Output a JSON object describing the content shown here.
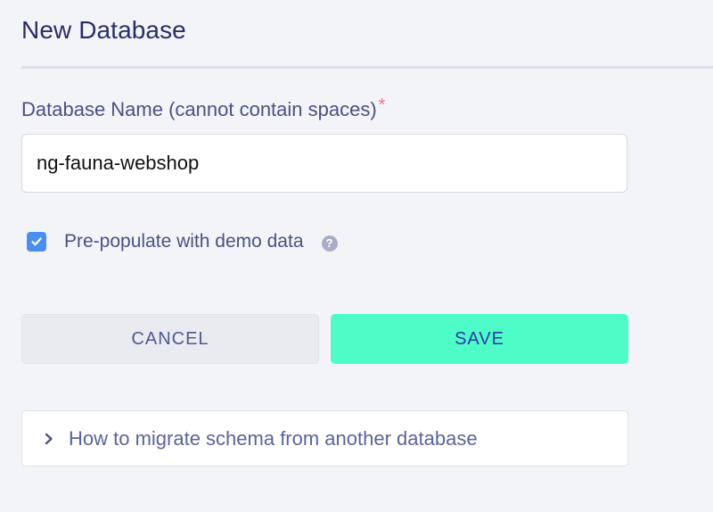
{
  "dialog": {
    "title": "New Database"
  },
  "form": {
    "name_label": "Database Name (cannot contain spaces)",
    "required_mark": "*",
    "name_value": "ng-fauna-webshop",
    "demo_data_checked": true,
    "demo_data_label": "Pre-populate with demo data",
    "help_icon_glyph": "?"
  },
  "actions": {
    "cancel_label": "CANCEL",
    "save_label": "SAVE"
  },
  "migrate": {
    "label": "How to migrate schema from another database"
  },
  "icons": {
    "checkbox": "checkmark-icon",
    "help": "question-circle-icon",
    "chevron": "chevron-right-icon"
  },
  "colors": {
    "accent_save": "#4dfcc6",
    "checkbox": "#4a8ef0",
    "required": "#f3767a",
    "title": "#2b2d66"
  }
}
